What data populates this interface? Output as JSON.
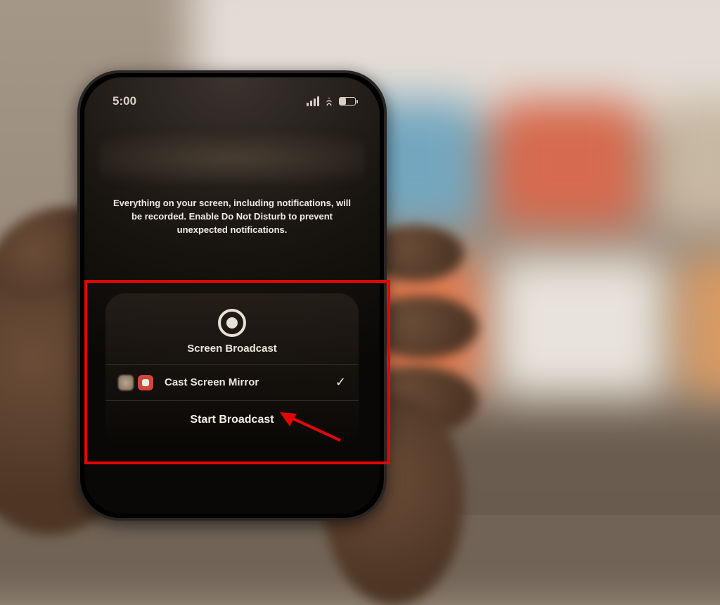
{
  "status": {
    "time": "5:00"
  },
  "sheet": {
    "description": "Everything on your screen, including notifications, will be recorded. Enable Do Not Disturb to prevent unexpected notifications.",
    "card_title": "Screen Broadcast",
    "option_label": "Cast Screen Mirror",
    "check_glyph": "✓",
    "start_label": "Start Broadcast"
  },
  "annotation": {
    "highlight_color": "#e40606"
  }
}
